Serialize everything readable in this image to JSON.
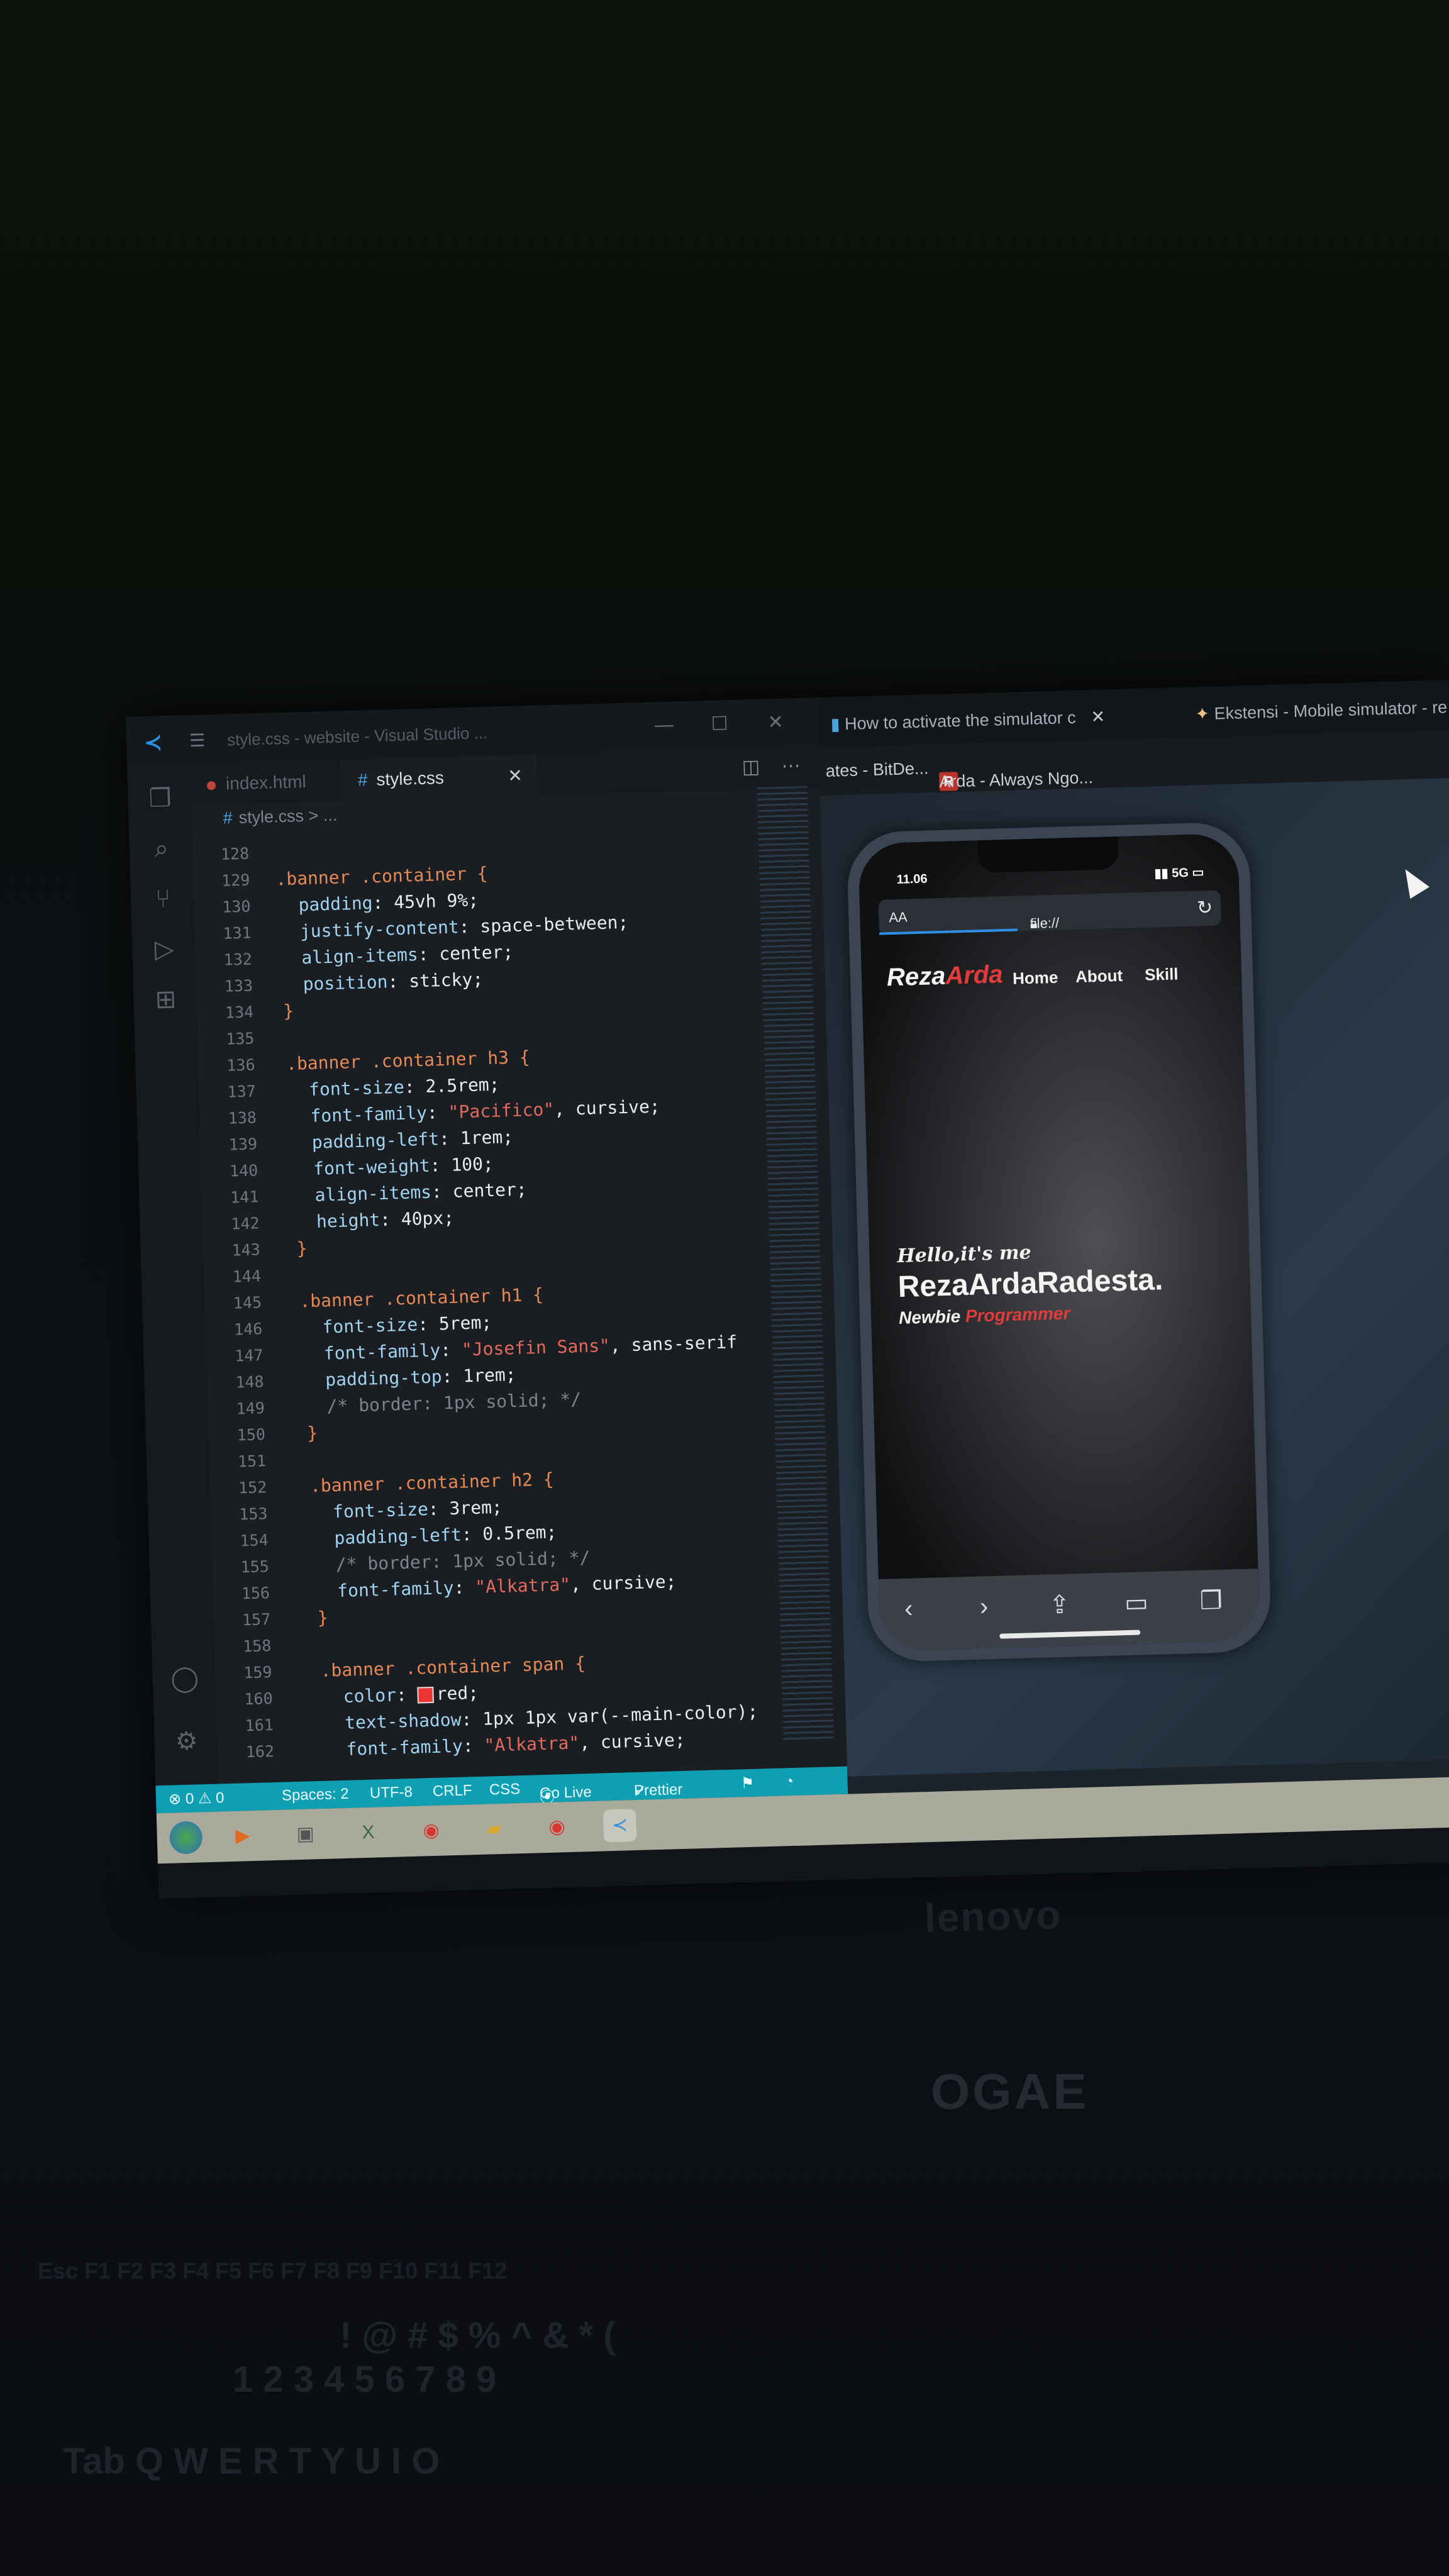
{
  "vscode": {
    "window_title": "style.css - website - Visual Studio ...",
    "tabs": [
      {
        "label": "index.html",
        "active": false
      },
      {
        "label": "style.css",
        "active": true
      }
    ],
    "breadcrumb": "style.css > ...",
    "code_lines": [
      {
        "n": "128",
        "segs": []
      },
      {
        "n": "129",
        "segs": [
          {
            "t": ".banner .container {",
            "c": "sel"
          }
        ]
      },
      {
        "n": "130",
        "segs": [
          {
            "t": "  padding",
            "c": "prop"
          },
          {
            "t": ": 45vh 9%;",
            "c": "val"
          }
        ]
      },
      {
        "n": "131",
        "segs": [
          {
            "t": "  justify-content",
            "c": "prop"
          },
          {
            "t": ": space-between;",
            "c": "val"
          }
        ]
      },
      {
        "n": "132",
        "segs": [
          {
            "t": "  align-items",
            "c": "prop"
          },
          {
            "t": ": center;",
            "c": "val"
          }
        ]
      },
      {
        "n": "133",
        "segs": [
          {
            "t": "  position",
            "c": "prop"
          },
          {
            "t": ": sticky;",
            "c": "val"
          }
        ]
      },
      {
        "n": "134",
        "segs": [
          {
            "t": "}",
            "c": "sel"
          }
        ]
      },
      {
        "n": "135",
        "segs": []
      },
      {
        "n": "136",
        "segs": [
          {
            "t": ".banner .container h3 {",
            "c": "sel"
          }
        ]
      },
      {
        "n": "137",
        "segs": [
          {
            "t": "  font-size",
            "c": "prop"
          },
          {
            "t": ": 2.5rem;",
            "c": "val"
          }
        ]
      },
      {
        "n": "138",
        "segs": [
          {
            "t": "  font-family",
            "c": "prop"
          },
          {
            "t": ": ",
            "c": "val"
          },
          {
            "t": "\"Pacifico\"",
            "c": "str"
          },
          {
            "t": ", cursive;",
            "c": "val"
          }
        ]
      },
      {
        "n": "139",
        "segs": [
          {
            "t": "  padding-left",
            "c": "prop"
          },
          {
            "t": ": 1rem;",
            "c": "val"
          }
        ]
      },
      {
        "n": "140",
        "segs": [
          {
            "t": "  font-weight",
            "c": "prop"
          },
          {
            "t": ": 100;",
            "c": "val"
          }
        ]
      },
      {
        "n": "141",
        "segs": [
          {
            "t": "  align-items",
            "c": "prop"
          },
          {
            "t": ": center;",
            "c": "val"
          }
        ]
      },
      {
        "n": "142",
        "segs": [
          {
            "t": "  height",
            "c": "prop"
          },
          {
            "t": ": 40px;",
            "c": "val"
          }
        ]
      },
      {
        "n": "143",
        "segs": [
          {
            "t": "}",
            "c": "sel"
          }
        ]
      },
      {
        "n": "144",
        "segs": []
      },
      {
        "n": "145",
        "segs": [
          {
            "t": ".banner .container h1 {",
            "c": "sel"
          }
        ]
      },
      {
        "n": "146",
        "segs": [
          {
            "t": "  font-size",
            "c": "prop"
          },
          {
            "t": ": 5rem;",
            "c": "val"
          }
        ]
      },
      {
        "n": "147",
        "segs": [
          {
            "t": "  font-family",
            "c": "prop"
          },
          {
            "t": ": ",
            "c": "val"
          },
          {
            "t": "\"Josefin Sans\"",
            "c": "str"
          },
          {
            "t": ", sans-serif",
            "c": "val"
          }
        ]
      },
      {
        "n": "148",
        "segs": [
          {
            "t": "  padding-top",
            "c": "prop"
          },
          {
            "t": ": 1rem;",
            "c": "val"
          }
        ]
      },
      {
        "n": "149",
        "segs": [
          {
            "t": "  /* border: 1px solid; */",
            "c": "cmt"
          }
        ]
      },
      {
        "n": "150",
        "segs": [
          {
            "t": "}",
            "c": "sel"
          }
        ]
      },
      {
        "n": "151",
        "segs": []
      },
      {
        "n": "152",
        "segs": [
          {
            "t": ".banner .container h2 {",
            "c": "sel"
          }
        ]
      },
      {
        "n": "153",
        "segs": [
          {
            "t": "  font-size",
            "c": "prop"
          },
          {
            "t": ": 3rem;",
            "c": "val"
          }
        ]
      },
      {
        "n": "154",
        "segs": [
          {
            "t": "  padding-left",
            "c": "prop"
          },
          {
            "t": ": 0.5rem;",
            "c": "val"
          }
        ]
      },
      {
        "n": "155",
        "segs": [
          {
            "t": "  /* border: 1px solid; */",
            "c": "cmt"
          }
        ]
      },
      {
        "n": "156",
        "segs": [
          {
            "t": "  font-family",
            "c": "prop"
          },
          {
            "t": ": ",
            "c": "val"
          },
          {
            "t": "\"Alkatra\"",
            "c": "str"
          },
          {
            "t": ", cursive;",
            "c": "val"
          }
        ]
      },
      {
        "n": "157",
        "segs": [
          {
            "t": "}",
            "c": "sel"
          }
        ]
      },
      {
        "n": "158",
        "segs": []
      },
      {
        "n": "159",
        "segs": [
          {
            "t": ".banner .container span {",
            "c": "sel"
          }
        ]
      },
      {
        "n": "160",
        "segs": [
          {
            "t": "  color",
            "c": "prop"
          },
          {
            "t": ": ",
            "c": "val"
          },
          {
            "t": "red;",
            "c": "val",
            "swatch": true
          }
        ]
      },
      {
        "n": "161",
        "segs": [
          {
            "t": "  text-shadow",
            "c": "prop"
          },
          {
            "t": ": 1px 1px var(--main-color);",
            "c": "val"
          }
        ]
      },
      {
        "n": "162",
        "segs": [
          {
            "t": "  font-family",
            "c": "prop"
          },
          {
            "t": ": ",
            "c": "val"
          },
          {
            "t": "\"Alkatra\"",
            "c": "str"
          },
          {
            "t": ", cursive;",
            "c": "val"
          }
        ]
      }
    ],
    "status": {
      "problems": "⊗ 0 ⚠ 0",
      "spaces": "Spaces: 2",
      "encoding": "UTF-8",
      "eol": "CRLF",
      "language": "CSS",
      "golive": "Go Live",
      "prettier": "Prettier"
    }
  },
  "browser": {
    "tabs": [
      {
        "label": "How to activate the simulator c"
      },
      {
        "label": "Ekstensi - Mobile simulator - re"
      }
    ],
    "bookmarks": [
      {
        "label": "ates - BitDe..."
      },
      {
        "label": "Arda - Always Ngo..."
      }
    ],
    "phone": {
      "time": "11.06",
      "signal": "5G",
      "url_left": "AA",
      "url": "file://",
      "site": {
        "logo_main": "Reza",
        "logo_accent": "Arda",
        "nav": [
          "Home",
          "About",
          "Skill"
        ],
        "hello": "Hello,it's me",
        "name": "RezaArdaRadesta.",
        "role_prefix": "Newbie",
        "role_accent": "Programmer"
      }
    }
  },
  "laptop": {
    "brand": "lenovo",
    "sticker": "OGAE"
  },
  "keyboard": {
    "fn_row": "Esc   F1   F2   F3   F4   F5   F6   F7   F8   F9   F10   F11   F12",
    "num_row": "!    @    #    $    %    ^    &    *    (",
    "num_row2": "1    2    3    4    5    6    7    8    9",
    "q_row": "Tab   Q    W    E    R    T    Y    U    I    O"
  }
}
